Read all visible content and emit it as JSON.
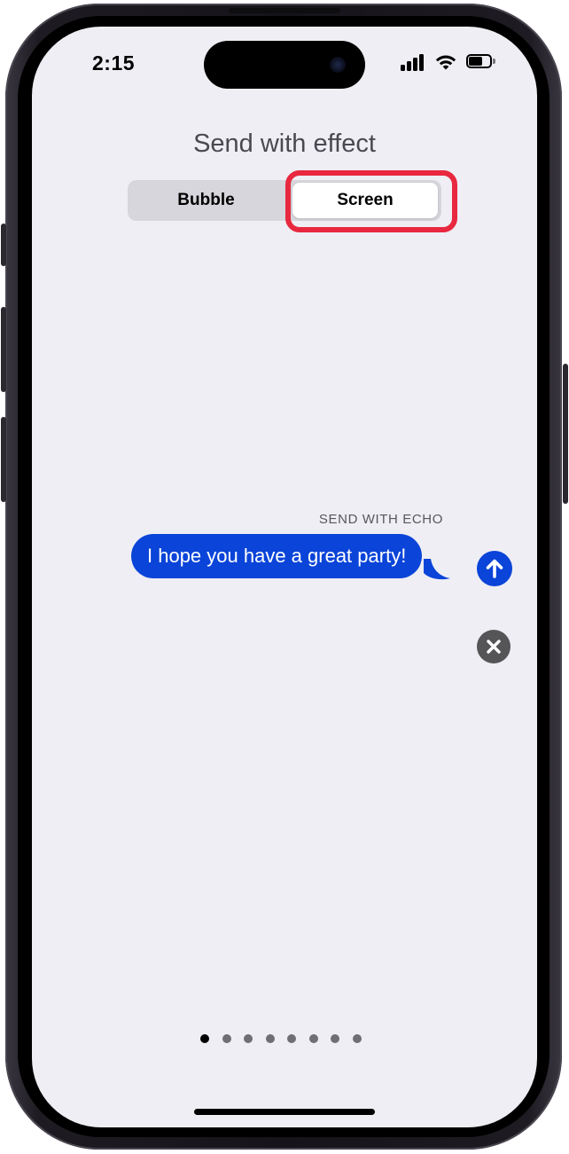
{
  "status_bar": {
    "time": "2:15",
    "battery_level": 0.65,
    "signal_bars": 4,
    "icons": [
      "signal-icon",
      "wifi-icon",
      "battery-icon"
    ]
  },
  "header": {
    "title": "Send with effect"
  },
  "segmented_control": {
    "options": [
      {
        "label": "Bubble",
        "selected": false
      },
      {
        "label": "Screen",
        "selected": true
      }
    ],
    "highlight_color": "#e8283f"
  },
  "message": {
    "effect_label": "SEND WITH ECHO",
    "text": "I hope you have a great party!",
    "bubble_color": "#0a44d8"
  },
  "actions": {
    "send_icon": "arrow-up-icon",
    "cancel_icon": "close-icon"
  },
  "page_indicator": {
    "total": 8,
    "current": 1
  },
  "colors": {
    "screen_background": "#efeef4",
    "accent": "#0a44d8"
  }
}
